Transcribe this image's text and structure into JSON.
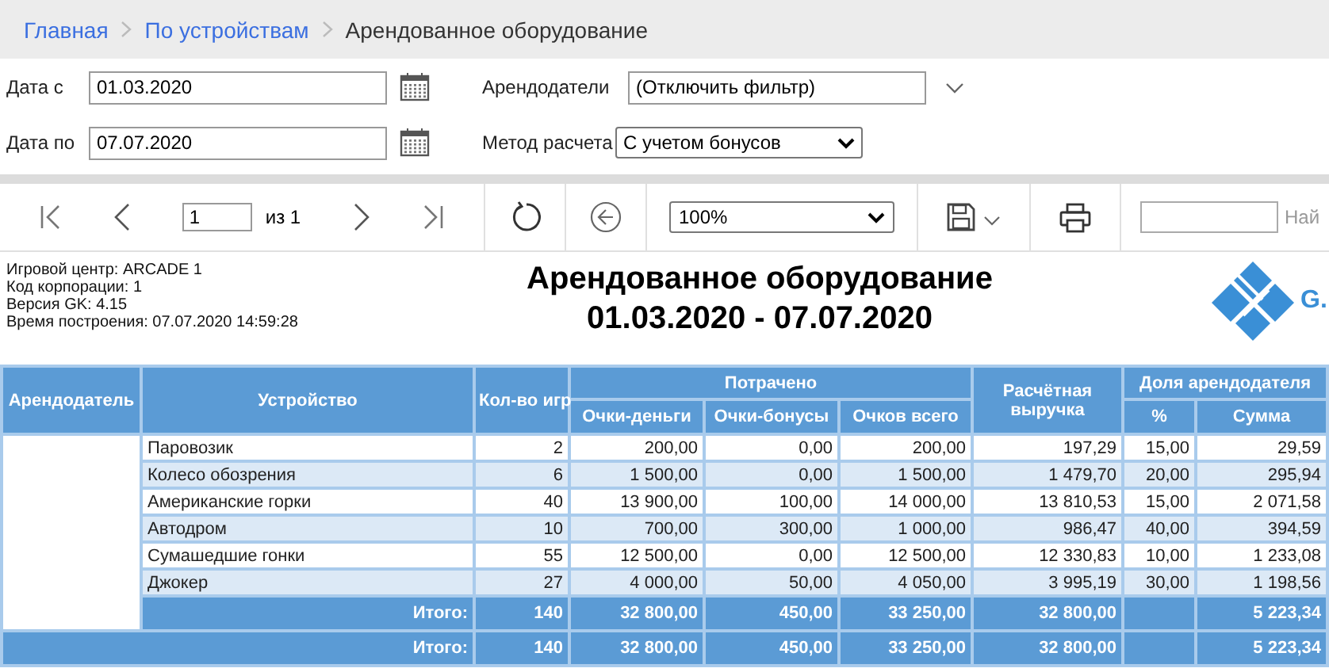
{
  "breadcrumb": [
    {
      "label": "Главная",
      "kind": "link"
    },
    {
      "label": "По устройствам",
      "kind": "link"
    },
    {
      "label": "Арендованное оборудование",
      "kind": "current"
    }
  ],
  "filters": {
    "date_from": {
      "label": "Дата с",
      "value": "01.03.2020"
    },
    "date_to": {
      "label": "Дата по",
      "value": "07.07.2020"
    },
    "lessors": {
      "label": "Арендодатели",
      "value": "(Отключить фильтр)"
    },
    "method": {
      "label": "Метод расчета",
      "value": "С учетом бонусов"
    }
  },
  "toolbar": {
    "page": "1",
    "page_of": "из 1",
    "zoom": "100%",
    "search_button": "Най"
  },
  "report": {
    "info": [
      "Игровой центр: ARCADE 1",
      "Код корпорации: 1",
      "Версия GK: 4.15",
      "Время построения: 07.07.2020 14:59:28"
    ],
    "title": "Арендованное оборудование",
    "period": "01.03.2020 - 07.07.2020",
    "logo_text": "G."
  },
  "table": {
    "columns": {
      "lessor": "Арендодатель",
      "device": "Устройство",
      "games": "Кол-во игр",
      "spent": "Потрачено",
      "money": "Очки-деньги",
      "bonus": "Очки-бонусы",
      "total": "Очков всего",
      "revenue": "Расчётная выручка",
      "share": "Доля арендодателя",
      "percent": "%",
      "sum": "Сумма"
    },
    "rows": [
      {
        "cells": [
          "Паровозик",
          "2",
          "200,00",
          "0,00",
          "200,00",
          "197,29",
          "15,00",
          "29,59"
        ]
      },
      {
        "cells": [
          "Колесо обозрения",
          "6",
          "1 500,00",
          "0,00",
          "1 500,00",
          "1 479,70",
          "20,00",
          "295,94"
        ]
      },
      {
        "cells": [
          "Американские горки",
          "40",
          "13 900,00",
          "100,00",
          "14 000,00",
          "13 810,53",
          "15,00",
          "2 071,58"
        ]
      },
      {
        "cells": [
          "Автодром",
          "10",
          "700,00",
          "300,00",
          "1 000,00",
          "986,47",
          "40,00",
          "394,59"
        ]
      },
      {
        "cells": [
          "Сумашедшие гонки",
          "55",
          "12 500,00",
          "0,00",
          "12 500,00",
          "12 330,83",
          "10,00",
          "1 233,08"
        ]
      },
      {
        "cells": [
          "Джокер",
          "27",
          "4 000,00",
          "50,00",
          "4 050,00",
          "3 995,19",
          "30,00",
          "1 198,56"
        ]
      }
    ],
    "subtotal": [
      "Итого:",
      "140",
      "32 800,00",
      "450,00",
      "33 250,00",
      "32 800,00",
      "5 223,34"
    ],
    "total": [
      "Итого:",
      "140",
      "32 800,00",
      "450,00",
      "33 250,00",
      "32 800,00",
      "5 223,34"
    ]
  }
}
